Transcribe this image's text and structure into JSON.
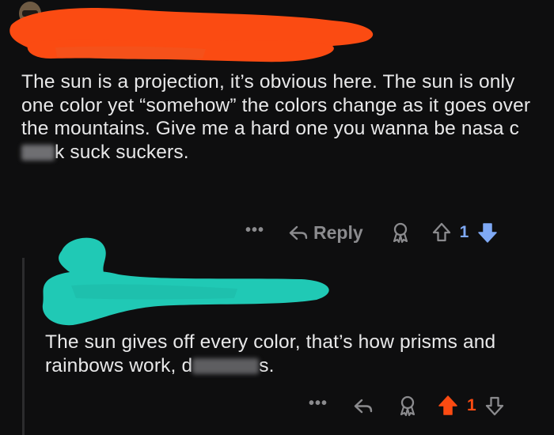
{
  "colors": {
    "background": "#0e0e0f",
    "redaction_orange": "#fb4b12",
    "redaction_teal": "#20c9b5",
    "upvote_active": "#fb4b12",
    "downvote_active": "#7fa9f5",
    "muted": "#8b8b8e"
  },
  "comments": [
    {
      "body_parts": [
        "The sun is a projection, it’s obvious here. The sun is only one color yet “somehow” the colors change as it goes over the mountains. Give me a hard one you wanna be nasa c",
        "k suck suckers."
      ],
      "actions": {
        "more": "•••",
        "reply_label": "Reply",
        "score": "1",
        "vote_state": "downvoted"
      },
      "icons": [
        "reply-arrow-icon",
        "award-icon",
        "upvote-arrow-icon",
        "downvote-arrow-icon"
      ]
    },
    {
      "body_parts": [
        "The sun gives off every color, that’s how prisms and rainbows work, d",
        "s."
      ],
      "actions": {
        "more": "•••",
        "score": "1",
        "vote_state": "upvoted"
      },
      "icons": [
        "reply-arrow-icon",
        "award-icon",
        "upvote-arrow-icon",
        "downvote-arrow-icon"
      ]
    }
  ]
}
